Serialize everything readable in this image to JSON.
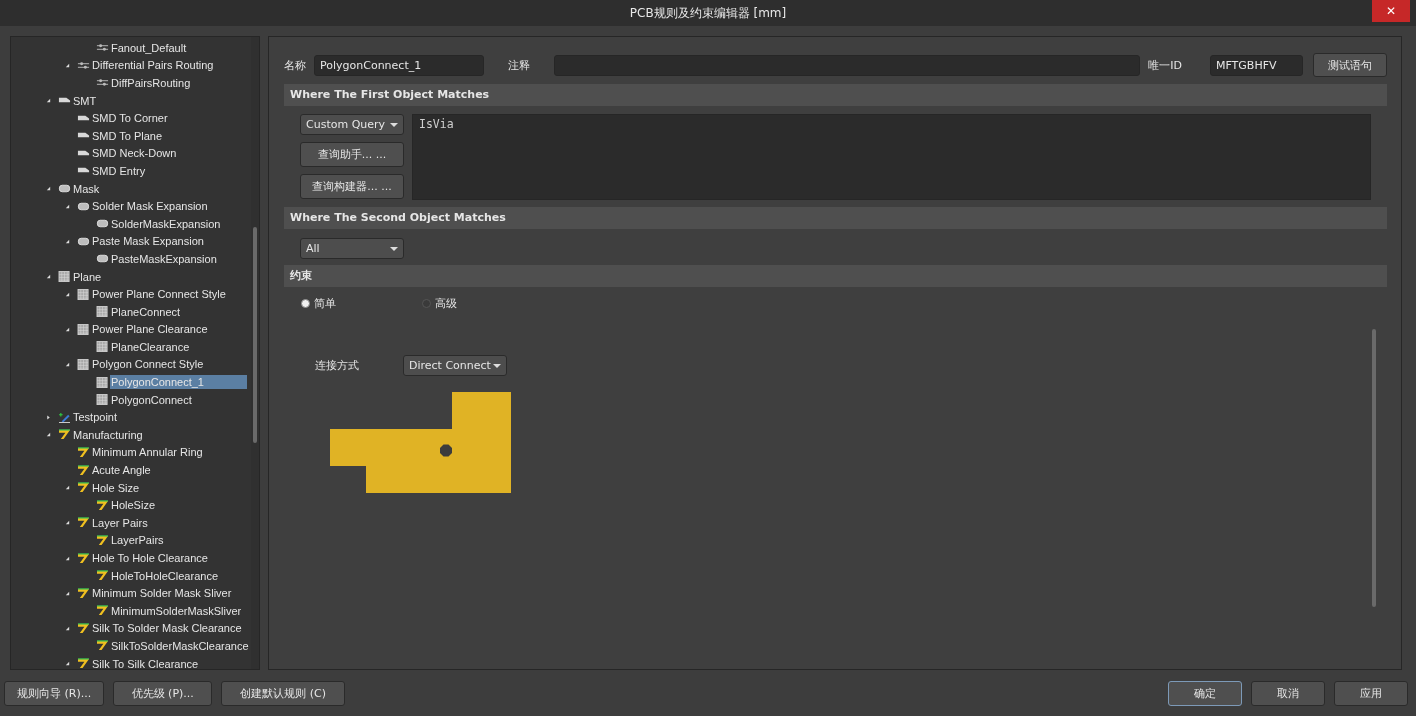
{
  "window": {
    "title": "PCB规则及约束编辑器 [mm]",
    "close": "✕"
  },
  "tree": [
    {
      "children": [
        {
          "children": [
            {
              "label": "Fanout_Default",
              "kind": "routing",
              "selected": false
            }
          ]
        },
        {
          "label": "Differential Pairs Routing",
          "kind": "routing",
          "expanded": true,
          "selected": false,
          "children": [
            {
              "label": "DiffPairsRouting",
              "kind": "routing",
              "selected": false
            }
          ]
        }
      ]
    },
    {
      "label": "SMT",
      "kind": "smt",
      "expanded": true,
      "selected": false,
      "children": [
        {
          "label": "SMD To Corner",
          "kind": "smt",
          "selected": false
        },
        {
          "label": "SMD To Plane",
          "kind": "smt",
          "selected": false
        },
        {
          "label": "SMD Neck-Down",
          "kind": "smt",
          "selected": false
        },
        {
          "label": "SMD Entry",
          "kind": "smt",
          "selected": false
        }
      ]
    },
    {
      "label": "Mask",
      "kind": "mask",
      "expanded": true,
      "selected": false,
      "children": [
        {
          "label": "Solder Mask Expansion",
          "kind": "mask",
          "expanded": true,
          "selected": false,
          "children": [
            {
              "label": "SolderMaskExpansion",
              "kind": "mask",
              "selected": false
            }
          ]
        },
        {
          "label": "Paste Mask Expansion",
          "kind": "mask",
          "expanded": true,
          "selected": false,
          "children": [
            {
              "label": "PasteMaskExpansion",
              "kind": "mask",
              "selected": false
            }
          ]
        }
      ]
    },
    {
      "label": "Plane",
      "kind": "plane",
      "expanded": true,
      "selected": false,
      "children": [
        {
          "label": "Power Plane Connect Style",
          "kind": "plane",
          "expanded": true,
          "selected": false,
          "children": [
            {
              "label": "PlaneConnect",
              "kind": "plane",
              "selected": false
            }
          ]
        },
        {
          "label": "Power Plane Clearance",
          "kind": "plane",
          "expanded": true,
          "selected": false,
          "children": [
            {
              "label": "PlaneClearance",
              "kind": "plane",
              "selected": false
            }
          ]
        },
        {
          "label": "Polygon Connect Style",
          "kind": "plane",
          "expanded": true,
          "selected": false,
          "children": [
            {
              "label": "PolygonConnect_1",
              "kind": "plane",
              "selected": true
            },
            {
              "label": "PolygonConnect",
              "kind": "plane",
              "selected": false
            }
          ]
        }
      ]
    },
    {
      "label": "Testpoint",
      "kind": "testpoint",
      "expanded": false,
      "selected": false
    },
    {
      "label": "Manufacturing",
      "kind": "manufacturing",
      "expanded": true,
      "selected": false,
      "children": [
        {
          "label": "Minimum Annular Ring",
          "kind": "manufacturing",
          "selected": false
        },
        {
          "label": "Acute Angle",
          "kind": "manufacturing",
          "selected": false
        },
        {
          "label": "Hole Size",
          "kind": "manufacturing",
          "expanded": true,
          "selected": false,
          "children": [
            {
              "label": "HoleSize",
              "kind": "manufacturing",
              "selected": false
            }
          ]
        },
        {
          "label": "Layer Pairs",
          "kind": "manufacturing",
          "expanded": true,
          "selected": false,
          "children": [
            {
              "label": "LayerPairs",
              "kind": "manufacturing",
              "selected": false
            }
          ]
        },
        {
          "label": "Hole To Hole Clearance",
          "kind": "manufacturing",
          "expanded": true,
          "selected": false,
          "children": [
            {
              "label": "HoleToHoleClearance",
              "kind": "manufacturing",
              "selected": false
            }
          ]
        },
        {
          "label": "Minimum Solder Mask Sliver",
          "kind": "manufacturing",
          "expanded": true,
          "selected": false,
          "children": [
            {
              "label": "MinimumSolderMaskSliver",
              "kind": "manufacturing",
              "selected": false
            }
          ]
        },
        {
          "label": "Silk To Solder Mask Clearance",
          "kind": "manufacturing",
          "expanded": true,
          "selected": false,
          "children": [
            {
              "label": "SilkToSolderMaskClearance",
              "kind": "manufacturing",
              "selected": false
            }
          ]
        },
        {
          "label": "Silk To Silk Clearance",
          "kind": "manufacturing",
          "expanded": true,
          "selected": false
        }
      ]
    }
  ],
  "rule": {
    "name_label": "名称",
    "name": "PolygonConnect_1",
    "comment_label": "注释",
    "id_label": "唯一ID",
    "id": "MFTGBHFV",
    "test_button": "测试语句"
  },
  "first_match": {
    "heading": "Where The First Object Matches",
    "query_type": "Custom Query",
    "helper_button": "查询助手... ...",
    "builder_button": "查询构建器... ...",
    "query": "IsVia"
  },
  "second_match": {
    "heading": "Where The Second Object Matches",
    "query_type": "All"
  },
  "constraints": {
    "heading": "约束",
    "modes": [
      {
        "label": "简单",
        "selected": true
      },
      {
        "label": "高级",
        "selected": false
      }
    ],
    "connect_label": "连接方式",
    "connect_style": "Direct Connect"
  },
  "footer_buttons": [
    "规则向导 (R)...",
    "优先级 (P)...",
    "创建默认规则 (C)"
  ],
  "dialog_buttons": [
    {
      "label": "确定",
      "focused": true
    },
    {
      "label": "取消",
      "focused": false
    },
    {
      "label": "应用",
      "focused": false
    }
  ]
}
